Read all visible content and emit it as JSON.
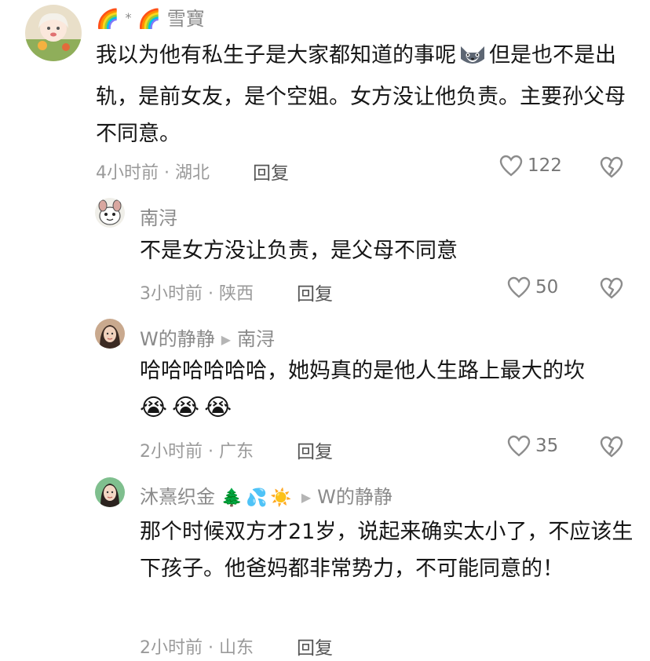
{
  "comments": [
    {
      "name_prefix": "🌈",
      "name_star": "*",
      "name_rainbow2": "🌈",
      "name": "雪寶",
      "text_before_emoji": "我以为他有私生子是大家都知道的事呢",
      "text_after_emoji": "但是也不是出轨，是前女友，是个空姐。女方没让他负责。主要孙父母不同意。",
      "time_location": "4小时前 · 湖北",
      "reply_label": "回复",
      "likes": "122",
      "avatar_icon": "girl-avatar-icon"
    },
    {
      "name": "南浔",
      "text": "不是女方没让负责，是父母不同意",
      "time_location": "3小时前 · 陕西",
      "reply_label": "回复",
      "likes": "50",
      "avatar_icon": "cartoon-animal-avatar-icon"
    },
    {
      "name": "W的静静",
      "reply_to": "南浔",
      "text": "哈哈哈哈哈哈，她妈真的是他人生路上最大的坎",
      "emojis": "😭😭😭",
      "time_location": "2小时前 · 广东",
      "reply_label": "回复",
      "likes": "35",
      "avatar_icon": "woman-avatar-icon"
    },
    {
      "name": "沐熹织金",
      "name_emojis": "🌲💦☀️",
      "reply_to": "W的静静",
      "text": "那个时候双方才21岁，说起来确实太小了，不应该生下孩子。他爸妈都非常势力，不可能同意的！",
      "time_location": "2小时前 · 山东",
      "reply_label": "回复",
      "avatar_icon": "woman-avatar-icon"
    }
  ],
  "colors": {
    "text": "#161616",
    "muted": "#8a8a8a",
    "icon": "#8c8c8c"
  },
  "icons": {
    "like": "heart-outline-icon",
    "dislike": "broken-heart-icon",
    "reply_arrow": "triangle-right-icon"
  }
}
